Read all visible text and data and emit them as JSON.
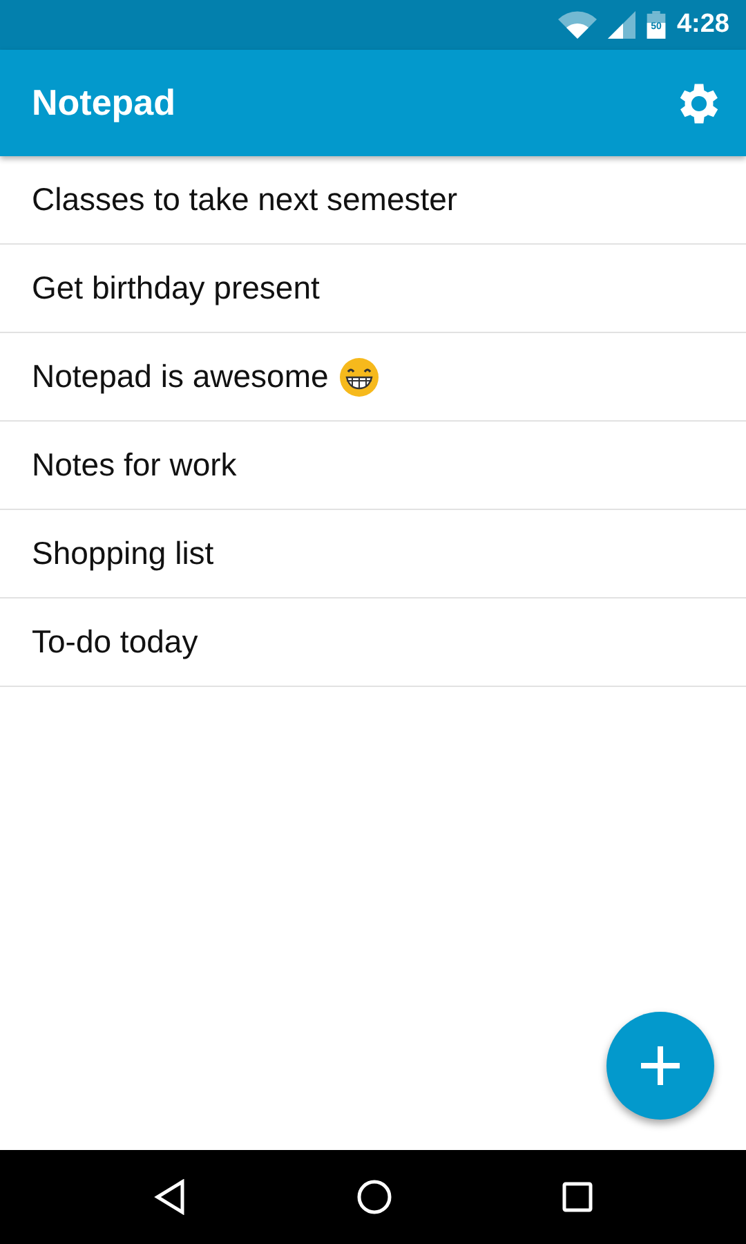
{
  "status_bar": {
    "battery_label": "50",
    "time": "4:28"
  },
  "app_bar": {
    "title": "Notepad"
  },
  "notes": [
    {
      "title": "Classes to take next semester",
      "kind": "plain"
    },
    {
      "title": "Get birthday present",
      "kind": "plain"
    },
    {
      "title": "Notepad is awesome",
      "kind": "emoji"
    },
    {
      "title": "Notes for work",
      "kind": "plain"
    },
    {
      "title": "Shopping list",
      "kind": "plain"
    },
    {
      "title": "To-do today",
      "kind": "plain"
    }
  ]
}
